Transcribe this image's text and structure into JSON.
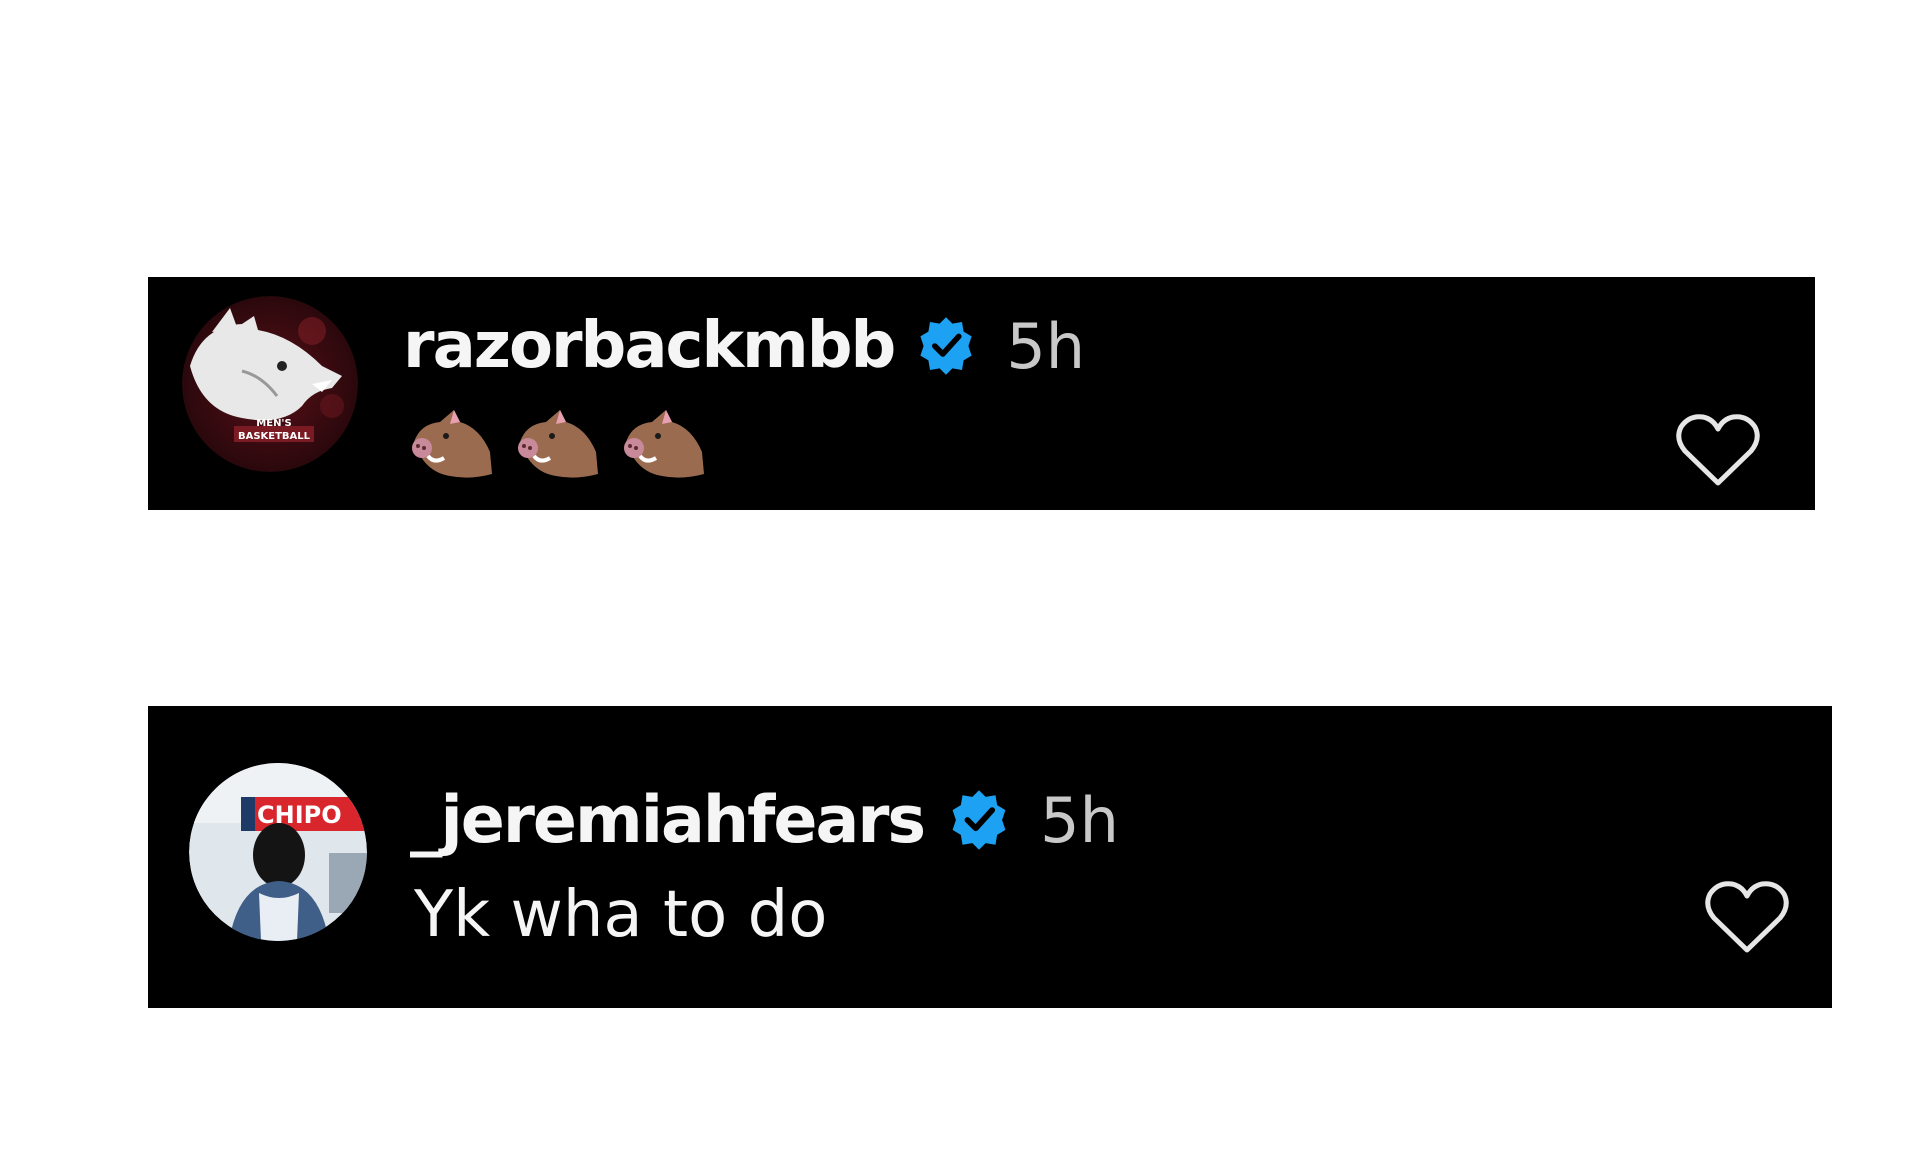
{
  "comments": [
    {
      "username": "razorbackmbb",
      "verified": true,
      "timestamp": "5h",
      "emoji": [
        "boar",
        "boar",
        "boar"
      ],
      "avatar_text": "MEN'S BASKETBALL",
      "like_icon": "heart-outline-icon"
    },
    {
      "username": "_jeremiahfears",
      "verified": true,
      "timestamp": "5h",
      "text": "Yk wha to do",
      "avatar_text": "CHIPO",
      "like_icon": "heart-outline-icon"
    }
  ],
  "colors": {
    "background": "#ffffff",
    "comment_background": "#000000",
    "username": "#f5f5f5",
    "timestamp": "#c8c8c8",
    "verified_badge": "#1da1f2",
    "heart_outline": "#e6e6e6"
  }
}
